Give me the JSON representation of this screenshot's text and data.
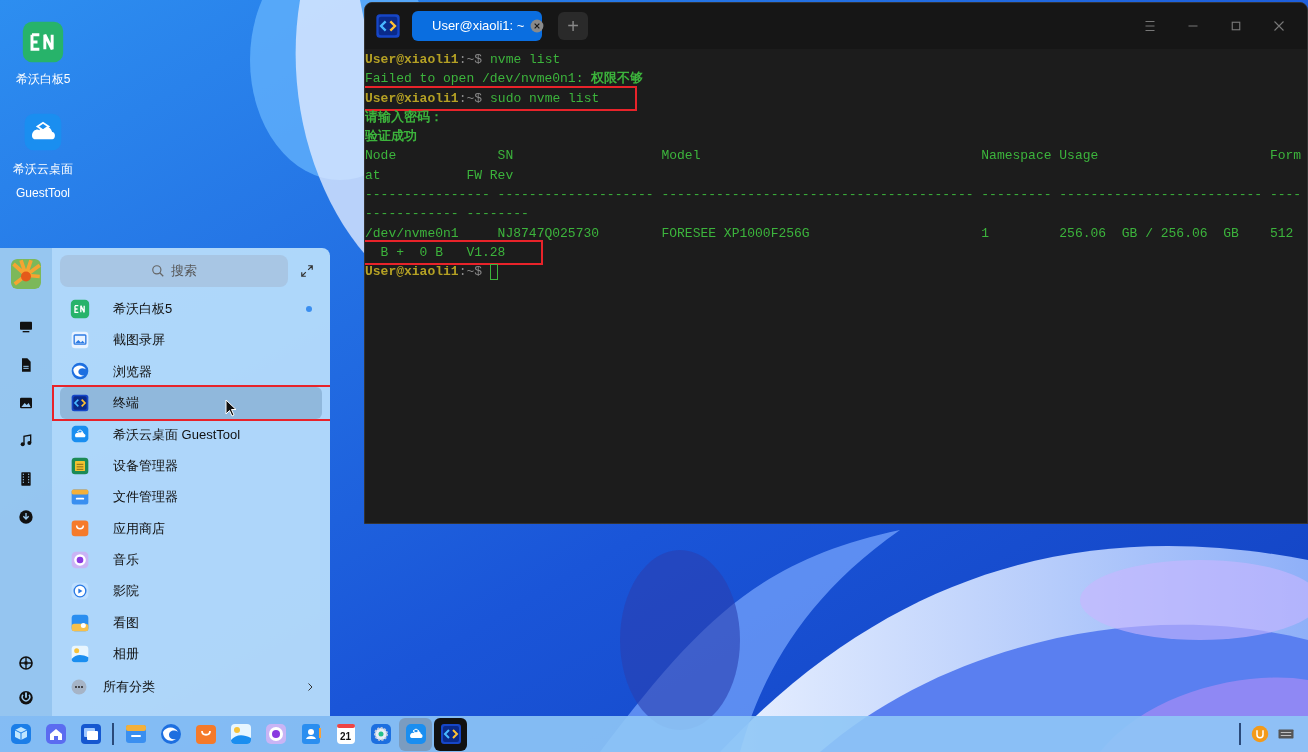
{
  "desktop_icons": [
    {
      "lines": [
        "希沃白板5"
      ]
    },
    {
      "lines": [
        "希沃云桌面",
        "GuestTool"
      ]
    }
  ],
  "terminal": {
    "tab_title": "User@xiaoli1: ~",
    "new_tab": "+",
    "lines": [
      {
        "kind": "prompt",
        "user": "User@xiaoli1",
        "path": ":~$",
        "command": "nvme list",
        "highlighted": false
      },
      {
        "kind": "output",
        "text": "Failed to open /dev/nvme0n1: **权限不够**",
        "highlighted": false
      },
      {
        "kind": "prompt",
        "user": "User@xiaoli1",
        "path": ":~$",
        "command": "sudo nvme list",
        "highlighted": true
      },
      {
        "kind": "output",
        "text": "**请输入密码：**",
        "highlighted": false
      },
      {
        "kind": "output",
        "text": "**验证成功**",
        "highlighted": false
      },
      {
        "kind": "output",
        "text": "Node             SN                   Model                                    Namespace Usage                      Form",
        "highlighted": false
      },
      {
        "kind": "output",
        "text": "at           FW Rev",
        "highlighted": false
      },
      {
        "kind": "output",
        "text": "---------------- -------------------- ---------------------------------------- --------- -------------------------- ----",
        "highlighted": false
      },
      {
        "kind": "output",
        "text": "------------ --------",
        "highlighted": false
      },
      {
        "kind": "output",
        "text": "/dev/nvme0n1     NJ8747Q025730        FORESEE XP1000F256G                      1         256.06  GB / 256.06  GB    512",
        "highlighted": false
      },
      {
        "kind": "output",
        "text": "  B +  0 B   V1.28",
        "highlighted": true
      },
      {
        "kind": "prompt",
        "user": "User@xiaoli1",
        "path": ":~$",
        "highlighted": false,
        "cursor": true
      }
    ]
  },
  "start_menu": {
    "search_placeholder": "搜索",
    "apps": [
      {
        "label": "希沃白板5",
        "new": true,
        "selected": false,
        "highlighted": false
      },
      {
        "label": "截图录屏",
        "new": false,
        "selected": false,
        "highlighted": false
      },
      {
        "label": "浏览器",
        "new": false,
        "selected": false,
        "highlighted": false
      },
      {
        "label": "终端",
        "new": false,
        "selected": true,
        "highlighted": true
      },
      {
        "label": "希沃云桌面 GuestTool",
        "new": false,
        "selected": false,
        "highlighted": false
      },
      {
        "label": "设备管理器",
        "new": false,
        "selected": false,
        "highlighted": false
      },
      {
        "label": "文件管理器",
        "new": false,
        "selected": false,
        "highlighted": false
      },
      {
        "label": "应用商店",
        "new": false,
        "selected": false,
        "highlighted": false
      },
      {
        "label": "音乐",
        "new": false,
        "selected": false,
        "highlighted": false
      },
      {
        "label": "影院",
        "new": false,
        "selected": false,
        "highlighted": false
      },
      {
        "label": "看图",
        "new": false,
        "selected": false,
        "highlighted": false
      },
      {
        "label": "相册",
        "new": false,
        "selected": false,
        "highlighted": false
      }
    ],
    "all_categories": "所有分类"
  },
  "taskbar": {
    "items": [
      {
        "open": false,
        "focused": false
      },
      {
        "open": false,
        "focused": false
      },
      {
        "open": false,
        "focused": false
      },
      {
        "open": false,
        "focused": false
      },
      {
        "open": false,
        "focused": false
      },
      {
        "open": false,
        "focused": false
      },
      {
        "open": false,
        "focused": false
      },
      {
        "open": false,
        "focused": false
      },
      {
        "open": false,
        "focused": false
      },
      {
        "open": false,
        "focused": false,
        "label": "21"
      },
      {
        "open": false,
        "focused": false
      },
      {
        "open": true,
        "focused": false
      },
      {
        "open": true,
        "focused": true
      }
    ]
  }
}
